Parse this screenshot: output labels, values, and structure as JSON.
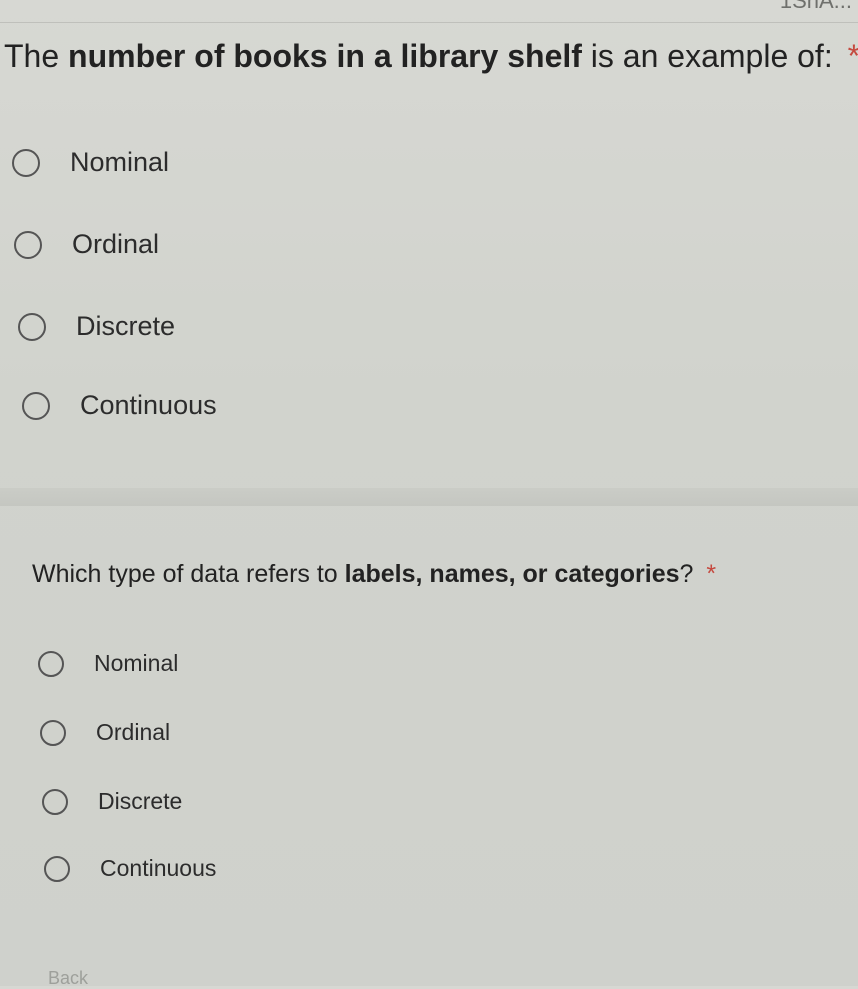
{
  "top_strip": {
    "text": "1ShA..."
  },
  "questions": [
    {
      "prefix": "The ",
      "bold": "number of books in a library shelf",
      "suffix": " is an example of: ",
      "required": "*",
      "options": [
        "Nominal",
        "Ordinal",
        "Discrete",
        "Continuous"
      ]
    },
    {
      "prefix": "Which type of data refers to ",
      "bold": "labels, names, or categories",
      "suffix": "? ",
      "required": "*",
      "options": [
        "Nominal",
        "Ordinal",
        "Discrete",
        "Continuous"
      ]
    }
  ],
  "footer": {
    "back_label": "Back"
  }
}
